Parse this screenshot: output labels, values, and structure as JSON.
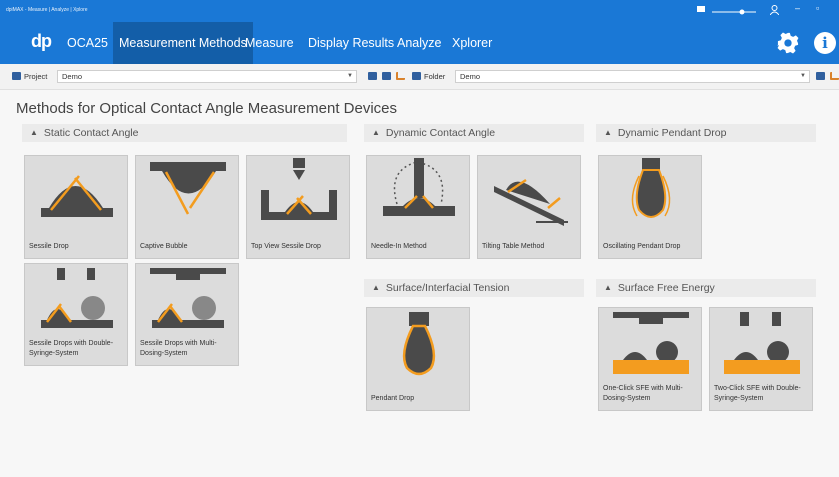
{
  "window": {
    "title": "dpiMAX - Measure | Analyze | Xplore"
  },
  "nav": {
    "logo": "dp",
    "items": [
      {
        "label": "OCA25"
      },
      {
        "label": "Measurement Methods"
      },
      {
        "label": "Measure"
      },
      {
        "label": "Display Results"
      },
      {
        "label": "Analyze"
      },
      {
        "label": "Xplorer"
      }
    ],
    "info_glyph": "i"
  },
  "toolbar": {
    "project_label": "Project",
    "project_value": "Demo",
    "folder_label": "Folder",
    "folder_value": "Demo"
  },
  "page": {
    "title": "Methods for Optical Contact Angle Measurement Devices"
  },
  "sections": {
    "static": {
      "title": "Static Contact Angle"
    },
    "dynamic": {
      "title": "Dynamic Contact Angle"
    },
    "pendant": {
      "title": "Dynamic Pendant Drop"
    },
    "tension": {
      "title": "Surface/Interfacial Tension"
    },
    "sfe": {
      "title": "Surface Free Energy"
    }
  },
  "cards": {
    "sessile": {
      "label": "Sessile Drop"
    },
    "captive": {
      "label": "Captive Bubble"
    },
    "topview": {
      "label": "Top View Sessile Drop"
    },
    "double": {
      "label": "Sessile Drops with Double-Syringe-System"
    },
    "multi": {
      "label": "Sessile Drops with Multi-Dosing-System"
    },
    "needle": {
      "label": "Needle-In Method"
    },
    "tilting": {
      "label": "Tilting Table Method"
    },
    "oscillating": {
      "label": "Oscillating Pendant Drop"
    },
    "pendantdrop": {
      "label": "Pendant Drop"
    },
    "oneclick": {
      "label": "One-Click SFE with Multi-Dosing-System"
    },
    "twoclick": {
      "label": "Two-Click SFE with Double-Syringe-System"
    }
  },
  "colors": {
    "accent": "#1a78d6",
    "nav_active": "#135ea8",
    "drop": "#f39c1f",
    "gray_shape": "#4a4a4a"
  }
}
